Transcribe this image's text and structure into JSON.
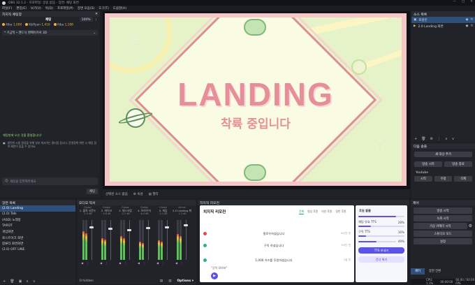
{
  "titlebar": {
    "title": "OBS 32.1.2 - 프로파일: 방송 없음 - 장면: 채팅 화면"
  },
  "menu": [
    "파일(F)",
    "편집(E)",
    "보기(V)",
    "독(D)",
    "프로파일(P)",
    "장면 모음(S)",
    "도구(T)",
    "도움말(H)"
  ],
  "chat": {
    "header": "치지직 채팅창",
    "tab": "채팅",
    "zoom": "100%",
    "donors": [
      {
        "name": "Alba",
        "amount": "1,000"
      },
      {
        "name": "K&Ryan",
        "amount": "1,416"
      },
      {
        "name": "Alba",
        "amount": "1,188"
      }
    ],
    "notice": "* 기금적 • 팬드닉 팬메이커서 3D",
    "welcome": "채팅방에 오신 것을 환영합니다!",
    "policy": "클린한 시청 환경을 위해 일부 게시어는 필터링 됩니다. 운영정책 위반 시 채팅 참여 제한이 있을 수 있어요.",
    "input_placeholder": "채팅을 입력해주세요",
    "send": "채팅"
  },
  "preview": {
    "title_text": "LANDING",
    "subtitle_text": "착륙 중입니다"
  },
  "sourcebar": {
    "label": "선택된 소스 없음",
    "props": "속성",
    "filter": "필터"
  },
  "sources": {
    "header": "소스 목록",
    "items": [
      {
        "name": "로컬빈",
        "selected": true
      },
      {
        "name": "2.0 Landing 화면",
        "selected": false
      }
    ]
  },
  "transitions": {
    "header": "다음 송출",
    "add": "새 대상 추가",
    "btn1": "방송 시작",
    "btn2": "방송 종료",
    "youtube": "Youtube",
    "yt1": "시작",
    "yt2": "수정",
    "yt3": "삭제"
  },
  "scenes": {
    "header": "장면 목록",
    "items": [
      "(2.0) Landing",
      "(2.0) Talk",
      "(ASD) 노래방",
      "TAROT",
      "게임화면",
      "로스트아크 화면",
      "합류타 화면화면",
      "(2.0) OFF LINE"
    ]
  },
  "audio": {
    "header": "오디오 믹서",
    "channels": [
      {
        "name": "1. 출력 사운드",
        "group": "Global",
        "db": "-1.9 dB",
        "level": 0.72,
        "fader": 0.85
      },
      {
        "name": "2. 마이크",
        "group": "Global",
        "db": "-4.6 dB",
        "level": 0.55,
        "fader": 0.8
      },
      {
        "name": "3. 데스크탑",
        "group": "Global",
        "db": "-3.2 dB",
        "level": 0.6,
        "fader": 0.78
      },
      {
        "name": "4. 브라우저",
        "group": "Global",
        "db": "-6.0 dB",
        "level": 0.45,
        "fader": 0.82
      },
      {
        "name": "5. 게임",
        "group": "Global",
        "db": "-2.1 dB",
        "level": 0.5,
        "fader": 0.84
      },
      {
        "name": "2.0 Landing 화면",
        "group": "Active",
        "db": "-1.2 dB",
        "level": 0.65,
        "fader": 0.9
      }
    ],
    "hidden": "0 hidden",
    "options": "Options"
  },
  "remote": {
    "header": "치지직 리모컨",
    "title": "치지직 리모컨",
    "tabs": [
      "전체",
      "영상 후원",
      "미션 후원",
      "일반 후원"
    ],
    "events": [
      {
        "msg": "팔로우하셨습니다",
        "time": "6시간 전",
        "color": "#e04b4b"
      },
      {
        "msg": "구독 하셨습니다",
        "time": "3시간 전",
        "color": "#2bb673"
      },
      {
        "msg": "1,000 치즈를 후원하셨습니다",
        "time": "1일 전",
        "color": "#2bb673"
      }
    ],
    "quote": "\"굿적 모아보\"",
    "side_title": "후원 볼륨",
    "tts_label": "채팅 유효 TTS",
    "tts_value": "28%",
    "sub_label": "구독 TTS",
    "sub_value": "16%",
    "slider3_value": "49%",
    "btn_tts": "TTS 보내기",
    "btn_skip": "건너 뛰기"
  },
  "controls": {
    "header": "제어",
    "buttons": [
      "방송 시작",
      "녹화 시작",
      "가상 카메라 시작",
      "스튜디오 모드",
      "설정"
    ],
    "tab1": "제어",
    "tab2": "장면 전환"
  },
  "status": {
    "cpu": "CPU: 1.1%",
    "time": "00:00:00",
    "fps": "60.00 / 60.00 FPS"
  }
}
